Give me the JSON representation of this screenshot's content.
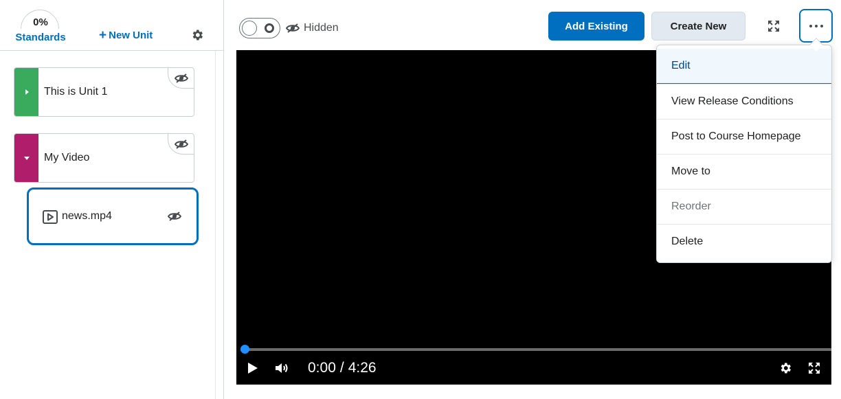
{
  "sidebar": {
    "standards": {
      "percent": "0%",
      "label": "Standards"
    },
    "new_unit": {
      "plus": "+",
      "label": "New Unit"
    },
    "settings_icon": "gear-icon",
    "units": [
      {
        "title": "This is Unit 1",
        "color": "#3aaa5c",
        "expanded": false,
        "visibility_icon": "eye-hidden-icon"
      },
      {
        "title": "My Video",
        "color": "#b01e6b",
        "expanded": true,
        "visibility_icon": "eye-hidden-icon"
      }
    ],
    "topic": {
      "title": "news.mp4",
      "icon": "video-icon",
      "visibility_icon": "eye-hidden-icon",
      "selected": true
    }
  },
  "toolbar": {
    "visibility_label": "Hidden",
    "add_existing_label": "Add Existing",
    "create_new_label": "Create New",
    "fullscreen_icon": "expand-icon",
    "more_icon": "more-horizontal-icon"
  },
  "menu": {
    "items": [
      {
        "label": "Edit",
        "state": "active"
      },
      {
        "label": "View Release Conditions",
        "state": "normal"
      },
      {
        "label": "Post to Course Homepage",
        "state": "normal"
      },
      {
        "label": "Move to",
        "state": "normal"
      },
      {
        "label": "Reorder",
        "state": "disabled"
      },
      {
        "label": "Delete",
        "state": "normal"
      }
    ]
  },
  "video": {
    "current_time": "0:00",
    "separator": "/",
    "duration": "4:26",
    "progress": 0,
    "accent_color": "#1e90ff"
  },
  "colors": {
    "brand": "#006fbf",
    "text": "#202122",
    "border": "#cdd2d8"
  }
}
